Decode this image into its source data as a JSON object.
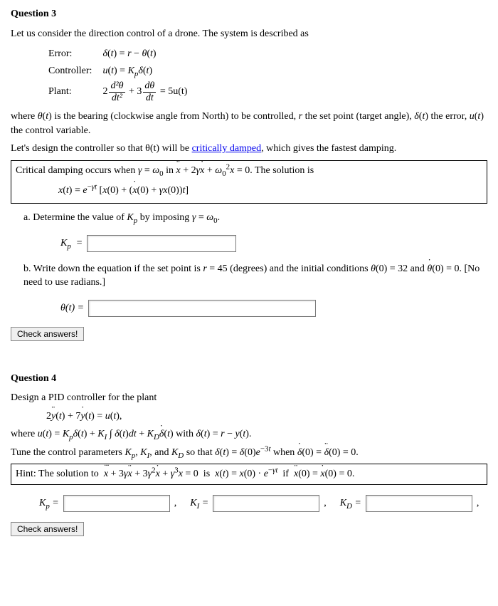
{
  "q3": {
    "heading": "Question 3",
    "intro": "Let us consider the direction control of a drone. The system is described as",
    "error_label": "Error:",
    "error_eq": "δ(t) = r − θ(t)",
    "controller_label": "Controller:",
    "controller_eq": "u(t) = K_p δ(t)",
    "plant_label": "Plant:",
    "plant_coef1": "2",
    "plant_frac1_num": "d²θ",
    "plant_frac1_den": "dt²",
    "plant_plus": " + 3",
    "plant_frac2_num": "dθ",
    "plant_frac2_den": "dt",
    "plant_rhs": " = 5u(t)",
    "where": "where θ(t) is the bearing (clockwise angle from North) to be controlled, r the set point (target angle), δ(t) the error, u(t) the control variable.",
    "design_pre": "Let's design the controller so that θ(t) will be ",
    "design_link": "critically damped",
    "design_post": ", which gives the fastest damping.",
    "crit_line": "Critical damping occurs when γ = ω₀ in ẍ + 2γẋ + ω₀²x = 0. The solution is",
    "crit_sol": "x(t) = e^{−γt} [x(0) + (ẋ(0) + γx(0))t]",
    "part_a": "a. Determine the value of K_p by imposing γ = ω₀.",
    "kp_label": "K_p  =",
    "part_b": "b. Write down the equation if the set point is r = 45 (degrees) and the initial conditions θ(0) = 32 and θ̇(0) = 0. [No need to use radians.]",
    "theta_label": "θ(t) =",
    "check_btn": "Check answers!"
  },
  "q4": {
    "heading": "Question 4",
    "intro": "Design a PID controller for the plant",
    "plant_eq": "2ÿ(t) + 7ẏ(t) = u(t),",
    "where": "where u(t) = K_p δ(t) + K_I ∫ δ(t)dt + K_D δ̇(t) with δ(t) = r − y(t).",
    "tune": "Tune the control parameters K_p, K_I, and K_D so that δ(t) = δ(0)e^{−3t} when δ̇(0) = δ̈(0) = 0.",
    "hint": "Hint: The solution to  ẍ˙ + 3γẍ + 3γ²ẋ + γ³x = 0  is  x(t) = x(0) · e^{−γt}  if  ẍ(0) = ẋ(0) = 0.",
    "kp_label": "K_p =",
    "ki_label": "K_I =",
    "kd_label": "K_D =",
    "comma": ",",
    "check_btn": "Check answers!"
  }
}
